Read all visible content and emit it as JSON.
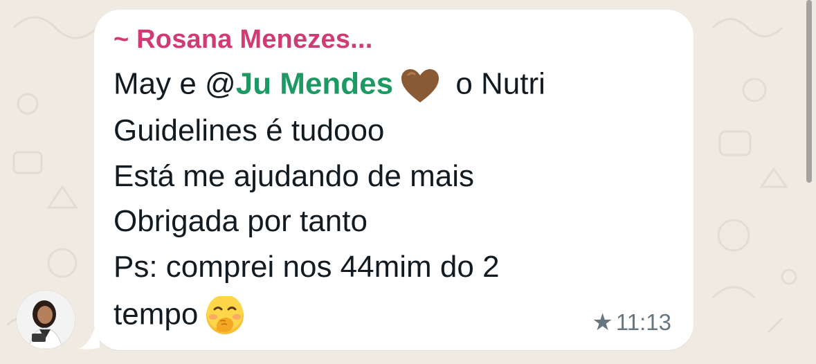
{
  "message": {
    "sender": "~ Rosana Menezes...",
    "line1_pre": "May e ",
    "mention_at": "@",
    "mention_name": "Ju Mendes",
    "line1_post": " o Nutri",
    "line2": "Guidelines é  tudooo",
    "line3": "Está me ajudando de mais",
    "line4": "Obrigada por tanto",
    "line5": "Ps: comprei nos 44mim do 2",
    "line6": "tempo",
    "emoji_heart": "brown-heart-icon",
    "emoji_face": "face-with-hand-over-mouth-icon",
    "time": "11:13",
    "starred": true,
    "star_glyph": "★"
  },
  "colors": {
    "sender_name": "#d23a74",
    "mention": "#1d9a63",
    "bubble": "#ffffff",
    "background": "#efeae2",
    "meta": "#667781"
  }
}
